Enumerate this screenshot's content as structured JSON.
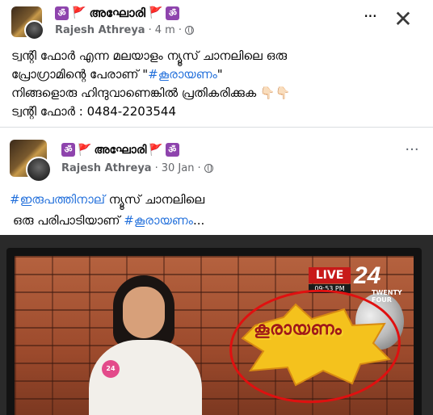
{
  "post": {
    "group_name": "അഘോരി",
    "author": "Rajesh Athreya",
    "time": "4 m",
    "dot": "·",
    "more": "···",
    "close": "✕",
    "line1": "ട്വന്റി ഫോർ എന്ന മലയാളം ന്യൂസ് ചാനലിലെ ഒരു",
    "line2_prefix": "പ്രോഗ്രാമിന്റെ പേരാണ് \"",
    "line2_tag": "#കൂരായണം",
    "line2_suffix": "\"",
    "line3": "നിങ്ങളൊരു ഹിന്ദുവാണെങ്കിൽ പ്രതികരിക്കുക 👇🏻👇🏻",
    "line4": "ട്വന്റി ഫോർ : 0484-2203544"
  },
  "shared": {
    "group_name": "അഘോരി",
    "author": "Rajesh Athreya",
    "time": "30 Jan",
    "dot": "·",
    "more": "···",
    "line1_tag": "#ഇരുപത്തിനാല്",
    "line1_rest": " ന്യൂസ് ചാനലിലെ",
    "line2_text": "ഒരു പരിപാടിയാണ് ",
    "line2_tag": "#കൂരായണം",
    "line2_suffix": "...",
    "photo": {
      "live": "LIVE",
      "time": "09:53 PM",
      "channel_number": "24",
      "channel_name": "TWENTY FOUR",
      "show_title": "കൂരായണം",
      "mic_logo": "24"
    }
  },
  "icons": {
    "om": "ॐ",
    "flag": "🚩"
  },
  "colors": {
    "link": "#216fdb",
    "muted": "#65676b",
    "om_bg": "#8e44ad",
    "flag": "#e02020",
    "live_red": "#c81919"
  }
}
